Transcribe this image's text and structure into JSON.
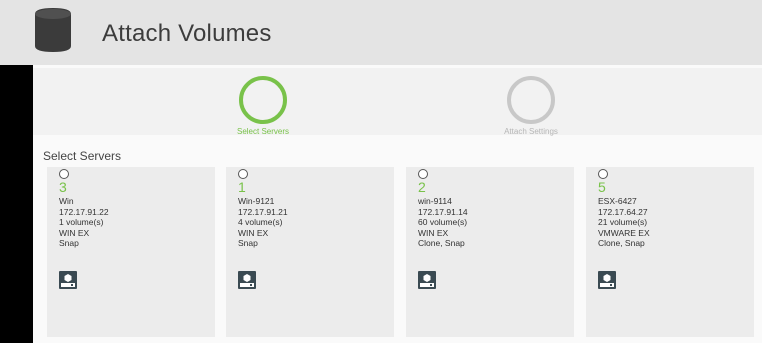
{
  "header": {
    "title": "Attach Volumes"
  },
  "wizard": {
    "steps": [
      {
        "label": "Select Servers",
        "state": "active"
      },
      {
        "label": "Attach Settings",
        "state": "inactive"
      }
    ]
  },
  "section": {
    "title": "Select Servers"
  },
  "servers": [
    {
      "count": "3",
      "name": "Win",
      "ip": "172.17.91.22",
      "volumes": "1 volume(s)",
      "os": "WIN EX",
      "features": "Snap"
    },
    {
      "count": "1",
      "name": "Win-9121",
      "ip": "172.17.91.21",
      "volumes": "4 volume(s)",
      "os": "WIN EX",
      "features": "Snap"
    },
    {
      "count": "2",
      "name": "win-9114",
      "ip": "172.17.91.14",
      "volumes": "60 volume(s)",
      "os": "WIN EX",
      "features": "Clone, Snap"
    },
    {
      "count": "5",
      "name": "ESX-6427",
      "ip": "172.17.64.27",
      "volumes": "21 volume(s)",
      "os": "VMWARE EX",
      "features": "Clone, Snap"
    }
  ],
  "icons": {
    "header": "database-icon",
    "server": "server-icon"
  },
  "colors": {
    "accent": "#79c24a",
    "inactive": "#c8c8c8",
    "icon_dark": "#3a4a52"
  }
}
